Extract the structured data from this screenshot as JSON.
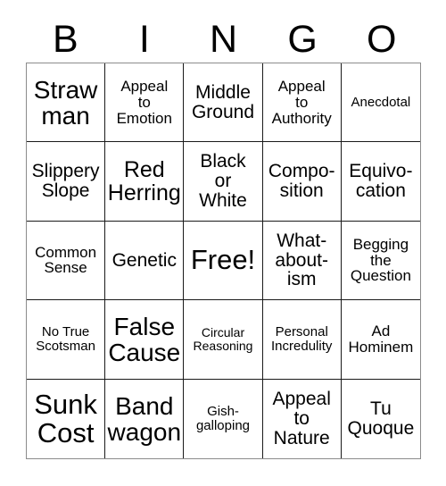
{
  "card": {
    "title": "BINGO",
    "header_letters": [
      "B",
      "I",
      "N",
      "G",
      "O"
    ],
    "grid_size": "5x5",
    "free_space_index": 12,
    "colors": {
      "background": "#ffffff",
      "text": "#000000",
      "inner_border": "#1a1a1a",
      "outer_border": "#8c8c8c"
    },
    "cells": [
      {
        "text": "Straw\nman",
        "size": "fs-xl"
      },
      {
        "text": "Appeal\nto\nEmotion",
        "size": "fs-sm"
      },
      {
        "text": "Middle\nGround",
        "size": "fs-md"
      },
      {
        "text": "Appeal\nto\nAuthority",
        "size": "fs-sm"
      },
      {
        "text": "Anecdotal",
        "size": "fs-xs"
      },
      {
        "text": "Slippery\nSlope",
        "size": "fs-md"
      },
      {
        "text": "Red\nHerring",
        "size": "fs-lg"
      },
      {
        "text": "Black\nor\nWhite",
        "size": "fs-md"
      },
      {
        "text": "Compo-\nsition",
        "size": "fs-md"
      },
      {
        "text": "Equivo-\ncation",
        "size": "fs-md"
      },
      {
        "text": "Common\nSense",
        "size": "fs-sm"
      },
      {
        "text": "Genetic",
        "size": "fs-md"
      },
      {
        "text": "Free!",
        "size": "fs-xxl"
      },
      {
        "text": "What-\nabout-\nism",
        "size": "fs-md"
      },
      {
        "text": "Begging\nthe\nQuestion",
        "size": "fs-sm"
      },
      {
        "text": "No True\nScotsman",
        "size": "fs-xs"
      },
      {
        "text": "False\nCause",
        "size": "fs-xl"
      },
      {
        "text": "Circular\nReasoning",
        "size": "fs-xxs"
      },
      {
        "text": "Personal\nIncredulity",
        "size": "fs-xs"
      },
      {
        "text": "Ad\nHominem",
        "size": "fs-sm"
      },
      {
        "text": "Sunk\nCost",
        "size": "fs-xxl"
      },
      {
        "text": "Band\nwagon",
        "size": "fs-xl"
      },
      {
        "text": "Gish-\ngalloping",
        "size": "fs-xs"
      },
      {
        "text": "Appeal\nto\nNature",
        "size": "fs-md"
      },
      {
        "text": "Tu\nQuoque",
        "size": "fs-md"
      }
    ]
  }
}
